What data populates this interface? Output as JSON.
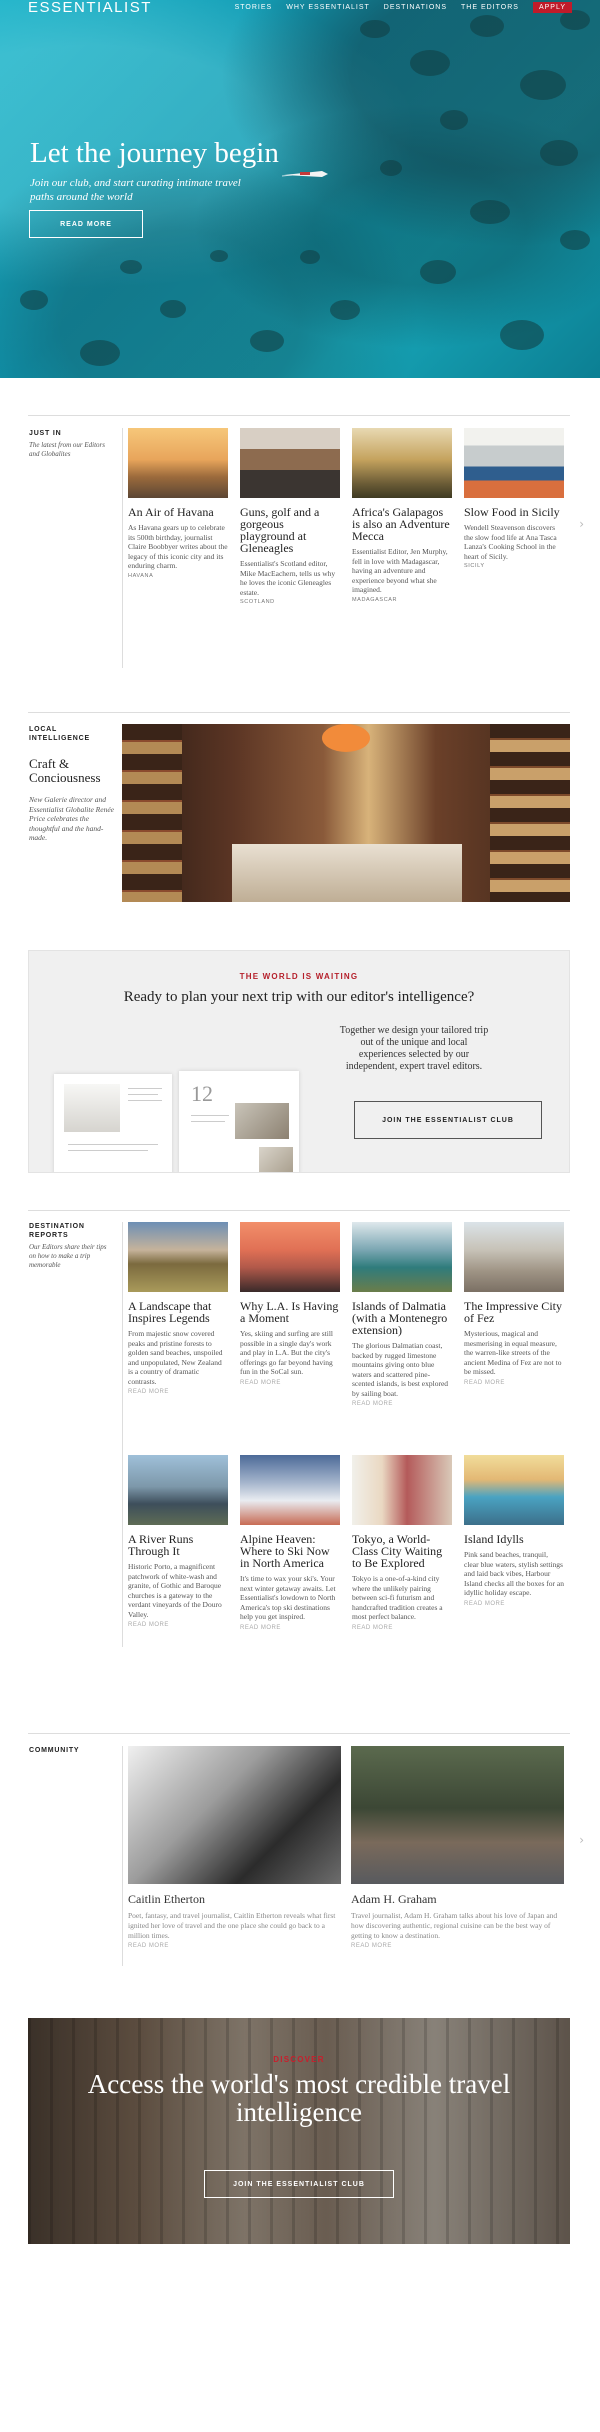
{
  "nav": {
    "logo": "ESSENTIALIST",
    "links": [
      "STORIES",
      "WHY ESSENTIALIST",
      "DESTINATIONS",
      "THE EDITORS"
    ],
    "apply": "APPLY"
  },
  "hero": {
    "title": "Let the journey begin",
    "subtitle": "Join our club, and start curating intimate travel paths around the world",
    "button": "READ MORE"
  },
  "just_in": {
    "title": "JUST IN",
    "desc": "The latest from our Editors and Globalites",
    "cards": [
      {
        "title": "An Air of Havana",
        "text": "As Havana gears up to celebrate its 500th birthday, journalist Claire Boobbyer writes about the legacy of this iconic city and its enduring charm.",
        "tag": "HAVANA"
      },
      {
        "title": "Guns, golf and a gorgeous playground at Gleneagles",
        "text": "Essentialist's Scotland editor, Mike MacEachern, tells us why he loves the iconic Gleneagles estate.",
        "tag": "SCOTLAND"
      },
      {
        "title": "Africa's Galapagos is also an Adventure Mecca",
        "text": "Essentialist Editor, Jen Murphy, fell in love with Madagascar, having an adventure and experience beyond what she imagined.",
        "tag": "MADAGASCAR"
      },
      {
        "title": "Slow Food in Sicily",
        "text": "Wendell Steavenson discovers the slow food life at Ana Tasca Lanza's Cooking School in the heart of Sicily.",
        "tag": "SICILY"
      }
    ],
    "arrow": "›"
  },
  "local": {
    "title": "LOCAL INTELLIGENCE",
    "feature_title": "Craft & Conciousness",
    "feature_desc": "New Galerie director and Essentialist Globalite Renée Price celebrates the thoughtful and the hand-made."
  },
  "waiting": {
    "kicker": "THE WORLD IS WAITING",
    "question": "Ready to plan your next trip with our editor's intelligence?",
    "text": "Together we design your tailored trip out of the unique and local experiences selected by our independent, expert travel editors.",
    "button": "JOIN THE ESSENTIALIST CLUB",
    "mag_number": "12"
  },
  "destinations": {
    "title": "DESTINATION REPORTS",
    "desc": "Our Editors share their tips on how to make a trip memorable",
    "more": "READ MORE",
    "cards": [
      {
        "title": "A Landscape that Inspires Legends",
        "text": "From majestic snow covered peaks and pristine forests to golden sand beaches, unspoiled and unpopulated, New Zealand is a country of dramatic contrasts."
      },
      {
        "title": "Why L.A. Is Having a Moment",
        "text": "Yes, skiing and surfing are still possible in a single day's work and play in L.A. But the city's offerings go far beyond having fun in the SoCal sun."
      },
      {
        "title": "Islands of Dalmatia (with a Montenegro extension)",
        "text": "The glorious Dalmatian coast, backed by rugged limestone mountains giving onto blue waters and scattered pine-scented islands, is best explored by sailing boat."
      },
      {
        "title": "The Impressive City of Fez",
        "text": "Mysterious, magical and mesmerising in equal measure, the warren-like streets of the ancient Medina of Fez are not to be missed."
      },
      {
        "title": "A River Runs Through It",
        "text": "Historic Porto, a magnificent patchwork of white-wash and granite, of Gothic and Baroque churches is a gateway to the verdant vineyards of the Douro Valley."
      },
      {
        "title": "Alpine Heaven: Where to Ski Now in North America",
        "text": "It's time to wax your ski's. Your next winter getaway awaits. Let Essentialist's lowdown to North America's top ski destinations help you get inspired."
      },
      {
        "title": "Tokyo, a World-Class City Waiting to Be Explored",
        "text": "Tokyo is a one-of-a-kind city where the unlikely pairing between sci-fi futurism and handcrafted tradition creates a most perfect balance."
      },
      {
        "title": "Island Idylls",
        "text": "Pink sand beaches, tranquil, clear blue waters, stylish settings and laid back vibes, Harbour Island checks all the boxes for an idyllic holiday escape."
      }
    ]
  },
  "community": {
    "title": "COMMUNITY",
    "more": "READ MORE",
    "arrow": "›",
    "people": [
      {
        "name": "Caitlin Etherton",
        "text": "Poet, fantasy, and travel journalist, Caitlin Etherton reveals what first ignited her love of travel and the one place she could go back to a million times."
      },
      {
        "name": "Adam H. Graham",
        "text": "Travel journalist, Adam H. Graham talks about his love of Japan and how discovering authentic, regional cuisine can be the best way of getting to know a destination."
      }
    ]
  },
  "bottom": {
    "kicker": "DISCOVER",
    "title": "Access the world's most credible travel intelligence",
    "button": "JOIN THE ESSENTIALIST CLUB"
  }
}
